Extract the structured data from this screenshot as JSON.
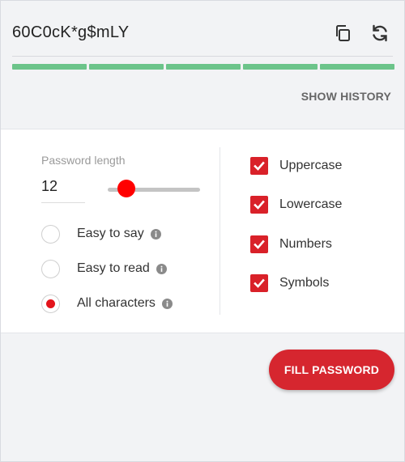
{
  "generator": {
    "password": "60C0cK*g$mLY",
    "copy_icon": "copy-icon",
    "refresh_icon": "refresh-icon",
    "strength_segments": 5,
    "strength_color": "#6cc48a",
    "show_history_label": "SHOW HISTORY"
  },
  "options": {
    "length_label": "Password length",
    "length_value": "12",
    "length_slider": {
      "value": 12,
      "min": 8,
      "max": 50
    },
    "modes": [
      {
        "label": "Easy to say",
        "selected": false,
        "info_icon": "info-icon"
      },
      {
        "label": "Easy to read",
        "selected": false,
        "info_icon": "info-icon"
      },
      {
        "label": "All characters",
        "selected": true,
        "info_icon": "info-icon"
      }
    ],
    "character_types": [
      {
        "label": "Uppercase",
        "checked": true
      },
      {
        "label": "Lowercase",
        "checked": true
      },
      {
        "label": "Numbers",
        "checked": true
      },
      {
        "label": "Symbols",
        "checked": true
      }
    ]
  },
  "actions": {
    "fill_password_label": "FILL PASSWORD"
  },
  "colors": {
    "accent": "#d6262f",
    "slider_thumb": "#ff0000",
    "strength": "#6cc48a"
  }
}
